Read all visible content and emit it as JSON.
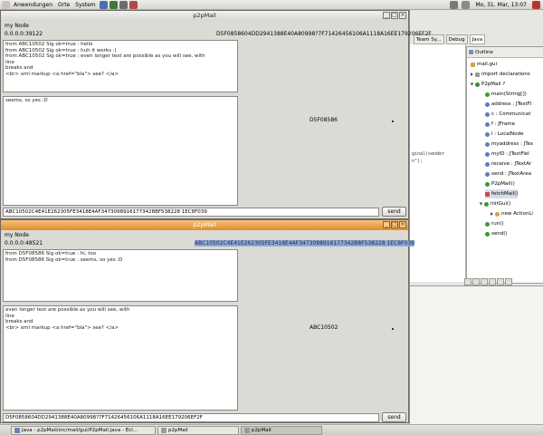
{
  "top_panel": {
    "menus": [
      "Anwendungen",
      "Orte",
      "System"
    ],
    "clock": "Mo, 31. Mar, 13:07"
  },
  "eclipse": {
    "tabs": [
      "Team Sy...",
      "Debug",
      "Java"
    ],
    "outline_title": "Outline",
    "outline_items": [
      "mail.gui",
      "import declarations",
      "P2pMail ?",
      "main(String[])",
      "address : JTextFi",
      "c : Communicat",
      "f : JFrame",
      "l : LocalNode",
      "myaddress : JTex",
      "myID : JTextFiel",
      "receive : JTextAr",
      "send : JTextArea",
      "P2pMail()",
      "fetchMail()",
      "initGui()",
      "new ActionLi",
      "run()",
      "send()"
    ],
    "code_fragments": [
      "ginal(sender",
      "n\");"
    ]
  },
  "window1": {
    "title": "p2pMail",
    "node_label": "my Node",
    "ip": "0.0.0.0:39122",
    "node_id": "D5F0858604DD2941388E40A80998?7F71426456106A1118A16EE179206EF2F",
    "inbox_lines": [
      "from ABC10502 Sig ok=true : hello",
      "from ABC10502 Sig ok=true : huh it works :)",
      "from ABC10502 Sig ok=true : even longer text are possible as you will see, with",
      "line",
      "breaks and",
      "<br> xml markup <a href=\"bla\"> see? </a>"
    ],
    "compose_lines": [
      "seems, so yes :D"
    ],
    "recipient_label": "D5F08586",
    "address_field": "ABC10502C4E41E262305FE3418E4AF34730989161773428BF538228 1EC8F039",
    "send_label": "send"
  },
  "window2": {
    "title": "p2pMail",
    "node_label": "my Node",
    "ip": "0.0.0.0:48521",
    "node_id": "ABC10502C4E41E262305FE3418E4AF3473098916177342B8F538228 1EC8F039",
    "inbox_lines": [
      "from D5F08586 Sig ok=true : hi, too",
      "from D5F08586 Sig ok=true : seems, so yes :D"
    ],
    "compose_lines": [
      "even longer text are possible as you will see, with",
      "line",
      "breaks and",
      "<br> xml markup <a href=\"bla\"> see? </a>"
    ],
    "recipient_label": "ABC10502",
    "address_field": "D5F0858604DD2941388E40A80998?7F71426456106A1118A16EE179206EF2F",
    "send_label": "send"
  },
  "taskbar": {
    "items": [
      "Java - p2pMail/src/mail/gui/P2pMail.java - Ecl...",
      "p2pMail",
      "p2pMail"
    ]
  }
}
